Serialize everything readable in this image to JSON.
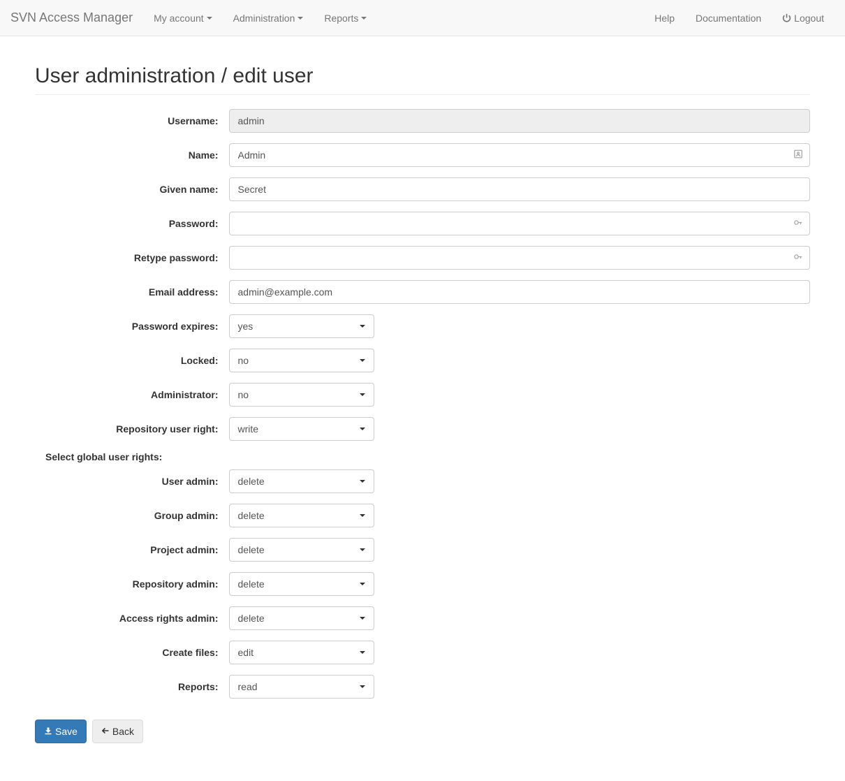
{
  "navbar": {
    "brand": "SVN Access Manager",
    "left": [
      {
        "label": "My account"
      },
      {
        "label": "Administration"
      },
      {
        "label": "Reports"
      }
    ],
    "right": [
      {
        "label": "Help"
      },
      {
        "label": "Documentation"
      },
      {
        "label": "Logout"
      }
    ]
  },
  "page_title": "User administration / edit user",
  "form": {
    "username": {
      "label": "Username:",
      "value": "admin"
    },
    "name": {
      "label": "Name:",
      "value": "Admin"
    },
    "given_name": {
      "label": "Given name:",
      "value": "Secret"
    },
    "password": {
      "label": "Password:",
      "value": ""
    },
    "retype_password": {
      "label": "Retype password:",
      "value": ""
    },
    "email": {
      "label": "Email address:",
      "value": "admin@example.com"
    },
    "password_expires": {
      "label": "Password expires:",
      "value": "yes"
    },
    "locked": {
      "label": "Locked:",
      "value": "no"
    },
    "administrator": {
      "label": "Administrator:",
      "value": "no"
    },
    "repo_user_right": {
      "label": "Repository user right:",
      "value": "write"
    }
  },
  "global_rights": {
    "section_label": "Select global user rights:",
    "user_admin": {
      "label": "User admin:",
      "value": "delete"
    },
    "group_admin": {
      "label": "Group admin:",
      "value": "delete"
    },
    "project_admin": {
      "label": "Project admin:",
      "value": "delete"
    },
    "repository_admin": {
      "label": "Repository admin:",
      "value": "delete"
    },
    "access_rights_admin": {
      "label": "Access rights admin:",
      "value": "delete"
    },
    "create_files": {
      "label": "Create files:",
      "value": "edit"
    },
    "reports": {
      "label": "Reports:",
      "value": "read"
    }
  },
  "buttons": {
    "save": "Save",
    "back": "Back"
  }
}
